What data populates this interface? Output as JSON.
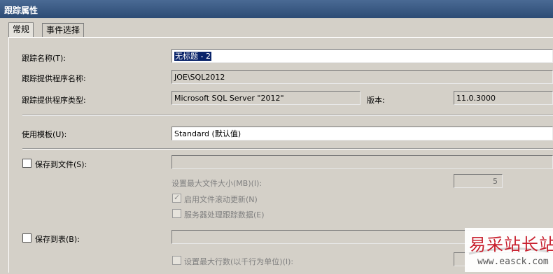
{
  "window": {
    "title": "跟踪属性"
  },
  "tabs": [
    {
      "label": "常规"
    },
    {
      "label": "事件选择"
    }
  ],
  "general": {
    "trace_name": {
      "label": "跟踪名称(T):",
      "value": "无标题 - 2"
    },
    "provider_name": {
      "label": "跟踪提供程序名称:",
      "value": "JOE\\SQL2012"
    },
    "provider_type": {
      "label": "跟踪提供程序类型:",
      "value": "Microsoft SQL Server \"2012\""
    },
    "version": {
      "label": "版本:",
      "value": "11.0.3000"
    },
    "template": {
      "label": "使用模板(U):",
      "value": "Standard (默认值)"
    },
    "save_to_file": {
      "label": "保存到文件(S):",
      "checked": false,
      "path": "",
      "max_size_label": "设置最大文件大小(MB)(I):",
      "max_size_value": "5",
      "rollover_label": "启用文件滚动更新(N)",
      "rollover_checked": true,
      "server_process_label": "服务器处理跟踪数据(E)",
      "server_process_checked": false
    },
    "save_to_table": {
      "label": "保存到表(B):",
      "checked": false,
      "table": "",
      "max_rows_label": "设置最大行数(以千行为单位)(I):",
      "max_rows_checked": false
    }
  },
  "watermark": {
    "text_cn": "易采站长站",
    "text_url": "www.easck.com"
  }
}
